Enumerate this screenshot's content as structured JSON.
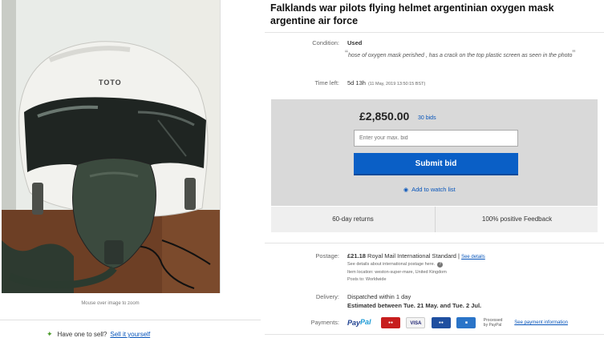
{
  "image": {
    "zoom_hint": "Mouse over image to zoom",
    "helmet_text": "TOTO"
  },
  "sell": {
    "prompt": "Have one to sell?",
    "link": "Sell it yourself"
  },
  "listing": {
    "title": "Falklands war pilots flying helmet argentinian oxygen mask argentine air force",
    "condition_label": "Condition:",
    "condition_value": "Used",
    "condition_note": "hose of oxygen mask perished , has a crack on the top plastic screen as seen in the photo",
    "time_left_label": "Time left:",
    "time_left_value": "5d 13h",
    "time_left_detail": "(11 May, 2019   13:50:15 BST)"
  },
  "bidding": {
    "price": "£2,850.00",
    "bids": "30 bids",
    "max_bid_placeholder": "Enter your max. bid",
    "submit_label": "Submit bid",
    "watch_label": "Add to watch list"
  },
  "features": {
    "returns": "60-day returns",
    "feedback": "100% positive Feedback"
  },
  "postage": {
    "label": "Postage:",
    "price": "£21.18",
    "service": "Royal Mail International Standard",
    "see_details": "See details",
    "line1": "See details about international postage here.",
    "line2": "Item location:  weston-super-mare, United Kingdom",
    "line3": "Posts to:  Worldwide"
  },
  "delivery": {
    "label": "Delivery:",
    "line1": "Dispatched within 1 day",
    "line2": "Estimated between Tue. 21 May. and Tue. 2 Jul."
  },
  "payments": {
    "label": "Payments:",
    "paypal_a": "Pay",
    "paypal_b": "Pal",
    "processed": "Processed by PayPal",
    "see_info": "See payment information",
    "card_visa": "VISA"
  }
}
